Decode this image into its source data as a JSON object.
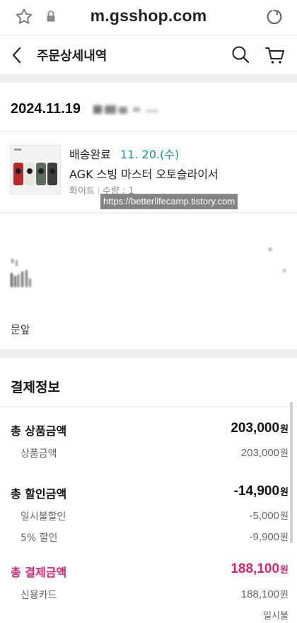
{
  "browser": {
    "url": "m.gsshop.com",
    "star_icon": "star-icon",
    "lock_icon": "lock-icon",
    "reload_icon": "reload-icon"
  },
  "header": {
    "title": "주문상세내역",
    "back_icon": "chevron-left-icon",
    "search_icon": "search-icon",
    "cart_icon": "cart-icon"
  },
  "order": {
    "date": "2024.11.19"
  },
  "item": {
    "status": "배송완료",
    "delivery_date": "11. 20.(수)",
    "name": "AGK 스빙 마스터 오토슬라이서",
    "option_color": "화이트",
    "option_qty": "수량 : 1",
    "watermark": "https://betterlifecamp.tistory.com"
  },
  "address": {
    "note": "문앞"
  },
  "payment": {
    "title": "결제정보",
    "total_product_label": "총 상품금액",
    "total_product_amount": "203,000",
    "product_label": "상품금액",
    "product_amount": "203,000",
    "total_discount_label": "총 할인금액",
    "total_discount_amount": "-14,900",
    "lump_discount_label": "일시불할인",
    "lump_discount_amount": "-5,000",
    "pct_discount_label": "5% 할인",
    "pct_discount_amount": "-9,900",
    "total_paid_label": "총 결제금액",
    "total_paid_amount": "188,100",
    "card_label": "신용카드",
    "card_amount": "188,100",
    "installment": "일시불",
    "won": "원"
  },
  "colors": {
    "accent_teal": "#1a8c8c",
    "accent_pink": "#d6246e"
  }
}
